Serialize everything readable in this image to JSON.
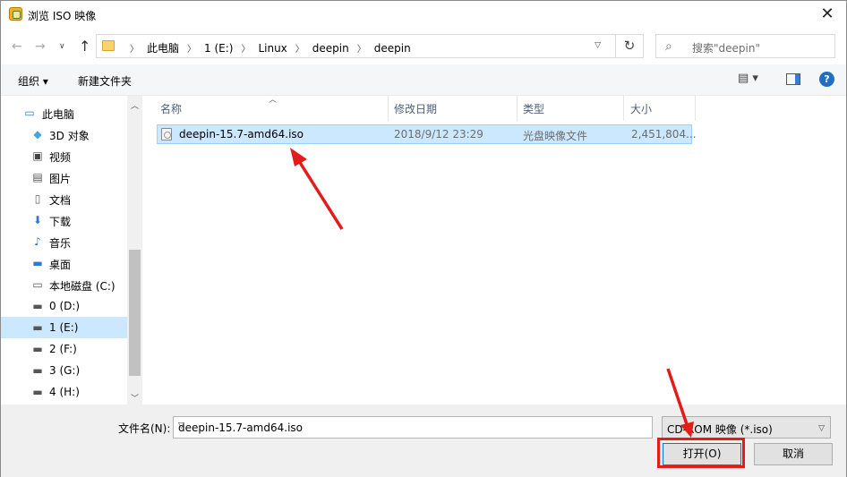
{
  "window": {
    "title": "浏览 ISO 映像",
    "close": "✕"
  },
  "nav": {
    "back": "←",
    "forward": "→",
    "recent": "∨",
    "up": "↑",
    "breadcrumb": [
      "此电脑",
      "1 (E:)",
      "Linux",
      "deepin",
      "deepin"
    ],
    "refresh": "↻",
    "search_placeholder": "搜索\"deepin\""
  },
  "toolbar": {
    "organize": "组织 ▾",
    "new_folder": "新建文件夹",
    "view": "▤ ▾",
    "help": "?"
  },
  "sidebar": {
    "items": [
      {
        "label": "此电脑",
        "icon": "computer-icon"
      },
      {
        "label": "3D 对象",
        "icon": "cube-icon"
      },
      {
        "label": "视频",
        "icon": "video-icon"
      },
      {
        "label": "图片",
        "icon": "picture-icon"
      },
      {
        "label": "文档",
        "icon": "document-icon"
      },
      {
        "label": "下载",
        "icon": "download-icon"
      },
      {
        "label": "音乐",
        "icon": "music-icon"
      },
      {
        "label": "桌面",
        "icon": "desktop-icon"
      },
      {
        "label": "本地磁盘 (C:)",
        "icon": "disk-icon"
      },
      {
        "label": "0 (D:)",
        "icon": "drive-icon"
      },
      {
        "label": "1 (E:)",
        "icon": "drive-icon",
        "selected": true
      },
      {
        "label": "2 (F:)",
        "icon": "drive-icon"
      },
      {
        "label": "3 (G:)",
        "icon": "drive-icon"
      },
      {
        "label": "4 (H:)",
        "icon": "drive-icon"
      }
    ]
  },
  "filelist": {
    "columns": [
      "名称",
      "修改日期",
      "类型",
      "大小"
    ],
    "rows": [
      {
        "name": "deepin-15.7-amd64.iso",
        "modified": "2018/9/12 23:29",
        "type": "光盘映像文件",
        "size": "2,451,804..."
      }
    ]
  },
  "bottom": {
    "filename_label": "文件名(N):",
    "filename_value": "deepin-15.7-amd64.iso",
    "filetype_value": "CD-ROM 映像 (*.iso)",
    "open_label": "打开(O)",
    "cancel_label": "取消"
  },
  "colors": {
    "selection": "#cce8ff",
    "accent": "#0078d7",
    "annotation": "#e21b1b"
  }
}
